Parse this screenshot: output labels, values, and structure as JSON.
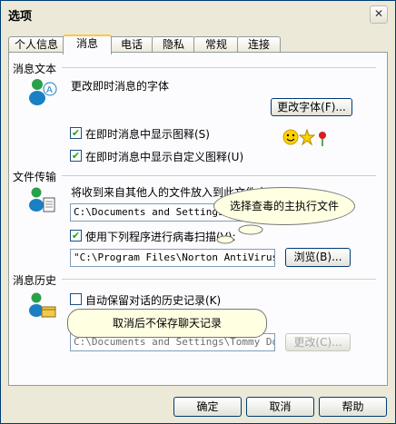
{
  "window": {
    "title": "选项",
    "close_glyph": "✕"
  },
  "tabs": [
    {
      "label": "个人信息"
    },
    {
      "label": "消息"
    },
    {
      "label": "电话"
    },
    {
      "label": "隐私"
    },
    {
      "label": "常规"
    },
    {
      "label": "连接"
    }
  ],
  "messages_text": {
    "group_label": "消息文本",
    "change_font_label": "更改即时消息的字体",
    "change_font_button": "更改字体(F)...",
    "show_emoticons": {
      "label": "在即时消息中显示图释(S)",
      "checked": true
    },
    "show_custom_emoticons": {
      "label": "在即时消息中显示自定义图释(U)",
      "checked": true
    }
  },
  "file_transfer": {
    "group_label": "文件传输",
    "description": "将收到来自其他人的文件放入到此文件夹",
    "folder_path": "C:\\Documents and Settings\\x",
    "virus_scan": {
      "label": "使用下列程序进行病毒扫描(V):",
      "checked": true
    },
    "scanner_path": "\"C:\\Program Files\\Norton AntiVirus\\NA",
    "browse_button": "浏览(B)..."
  },
  "history": {
    "group_label": "消息历史",
    "auto_save": {
      "label": "自动保留对话的历史记录(K)",
      "checked": false
    },
    "path": "C:\\Documents and Settings\\Tommy Doc",
    "change_button": "更改(C)..."
  },
  "callouts": {
    "scanner_hint": "选择查毒的主执行文件",
    "history_hint": "取消后不保存聊天记录"
  },
  "footer": {
    "ok": "确定",
    "cancel": "取消",
    "help": "帮助"
  },
  "check_glyph": "✔"
}
